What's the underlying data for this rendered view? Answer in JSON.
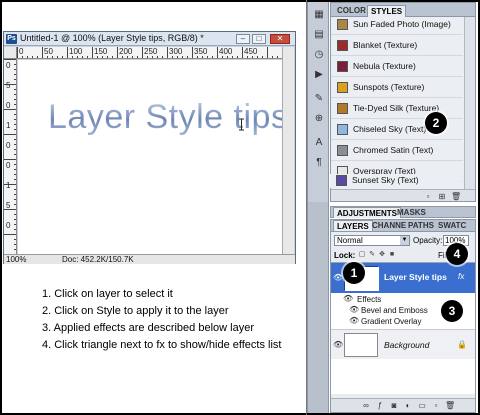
{
  "document": {
    "badge": "Ps",
    "title": "Untitled-1 @ 100% (Layer Style tips, RGB/8) *",
    "controls": {
      "min": "–",
      "max": "□",
      "close": "✕"
    },
    "ruler_top_labels": [
      "0",
      "50",
      "100",
      "150",
      "200",
      "250",
      "300",
      "350",
      "400",
      "450"
    ],
    "ruler_left_labels": [
      "0",
      "5",
      "0",
      "1",
      "0",
      "0",
      "1",
      "5",
      "0"
    ],
    "canvas_text": "Layer Style tips",
    "zoom": "100%",
    "info": "Doc: 452.2K/150.7K"
  },
  "instructions": [
    "1. Click on layer to select it",
    "2. Click on Style to apply it to the layer",
    "3. Applied effects are described below layer",
    "4. Click triangle next to fx to show/hide effects list"
  ],
  "styles_panel": {
    "tabs": [
      "COLOR",
      "STYLES"
    ],
    "items": [
      {
        "name": "Sun Faded Photo (Image)",
        "color": "#a9864a"
      },
      {
        "name": "Blanket (Texture)",
        "color": "#9b2c2c"
      },
      {
        "name": "Nebula (Texture)",
        "color": "#7a1e3a"
      },
      {
        "name": "Sunspots (Texture)",
        "color": "#d8a220"
      },
      {
        "name": "Tie-Dyed Silk (Texture)",
        "color": "#b07a2a"
      },
      {
        "name": "Chiseled Sky (Text)",
        "color": "#8fb6e0"
      },
      {
        "name": "Chromed Satin (Text)",
        "color": "#8a8f96"
      },
      {
        "name": "Overspray (Text)",
        "color": "#e7e7e7"
      },
      {
        "name": "Sunset Sky (Text)",
        "color": "#5a4aa0"
      }
    ]
  },
  "adjustments_tabs": [
    "ADJUSTMENTS",
    "MASKS"
  ],
  "layers_panel": {
    "tabs": [
      "LAYERS",
      "CHANNE",
      "PATHS",
      "SWATC"
    ],
    "blend_mode": "Normal",
    "opacity_label": "Opacity:",
    "opacity_value": "100%",
    "lock_label": "Lock:",
    "fill_label": "Fill:",
    "text_layer": {
      "name": "Layer Style tips",
      "thumb_glyph": "T",
      "fx": "fx"
    },
    "effects_label": "Effects",
    "effects": [
      "Bevel and Emboss",
      "Gradient Overlay"
    ],
    "background_layer": {
      "name": "Background",
      "lock": "🔒"
    }
  },
  "callouts": [
    "1",
    "2",
    "3",
    "4"
  ],
  "colors": {
    "selected_layer": "#3a6fd0",
    "panel": "#ebeef2",
    "callout": "#000000"
  }
}
